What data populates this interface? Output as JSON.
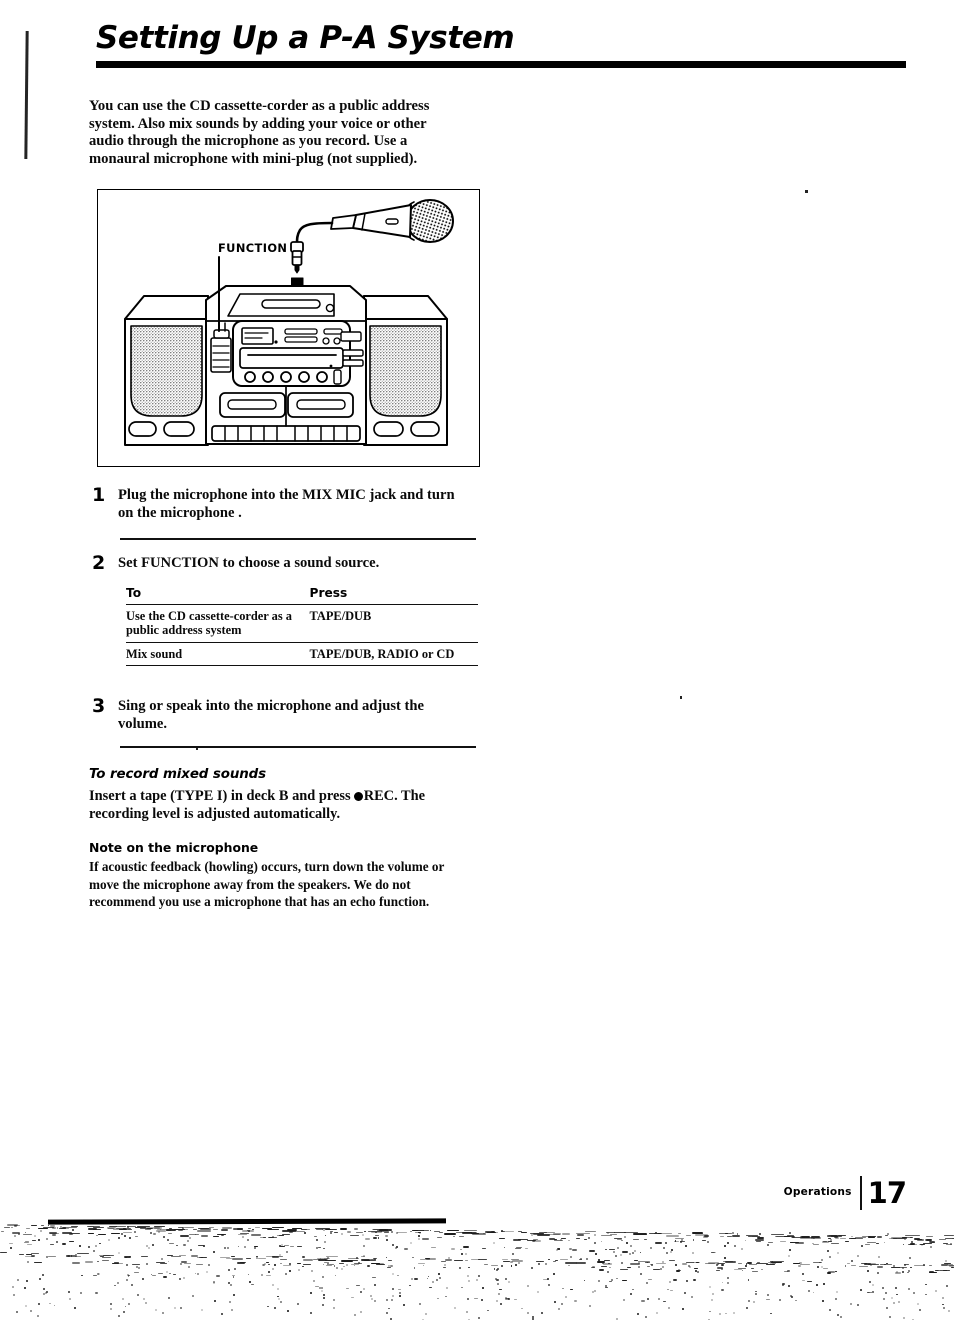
{
  "document": {
    "title": "Setting Up a P-A System",
    "intro": "You can use the CD cassette-corder as a public address system. Also mix sounds by adding your voice or other audio through the microphone as you record. Use a monaural microphone with mini-plug (not supplied)."
  },
  "figure": {
    "label_function": "FUNCTION",
    "description": "CD cassette-corder front view with monaural microphone and mini-plug being inserted"
  },
  "steps": [
    {
      "number": "1",
      "text": "Plug the microphone into the MIX MIC jack and turn on the microphone ."
    },
    {
      "number": "2",
      "text": "Set FUNCTION to choose a sound source."
    },
    {
      "number": "3",
      "text": "Sing or speak into the microphone and adjust the volume."
    }
  ],
  "table": {
    "headers": [
      "To",
      "Press"
    ],
    "rows": [
      {
        "to": "Use the CD cassette-corder as a public address system",
        "press": "TAPE/DUB"
      },
      {
        "to": "Mix sound",
        "press": "TAPE/DUB, RADIO or CD"
      }
    ]
  },
  "record_section": {
    "heading": "To record mixed sounds",
    "body_before_dot": "Insert a tape (TYPE I) in deck B and press ",
    "body_after_dot": "REC. The recording level is adjusted automatically."
  },
  "note_section": {
    "heading": "Note on the microphone",
    "body": "If acoustic feedback (howling) occurs, turn down the volume or move the microphone away from the speakers. We do not recommend you use a microphone that has an echo function."
  },
  "footer": {
    "section": "Operations",
    "page_number": "17"
  },
  "colors": {
    "ink": "#0a0a0a",
    "paper": "#ffffff",
    "rule": "#000000"
  }
}
